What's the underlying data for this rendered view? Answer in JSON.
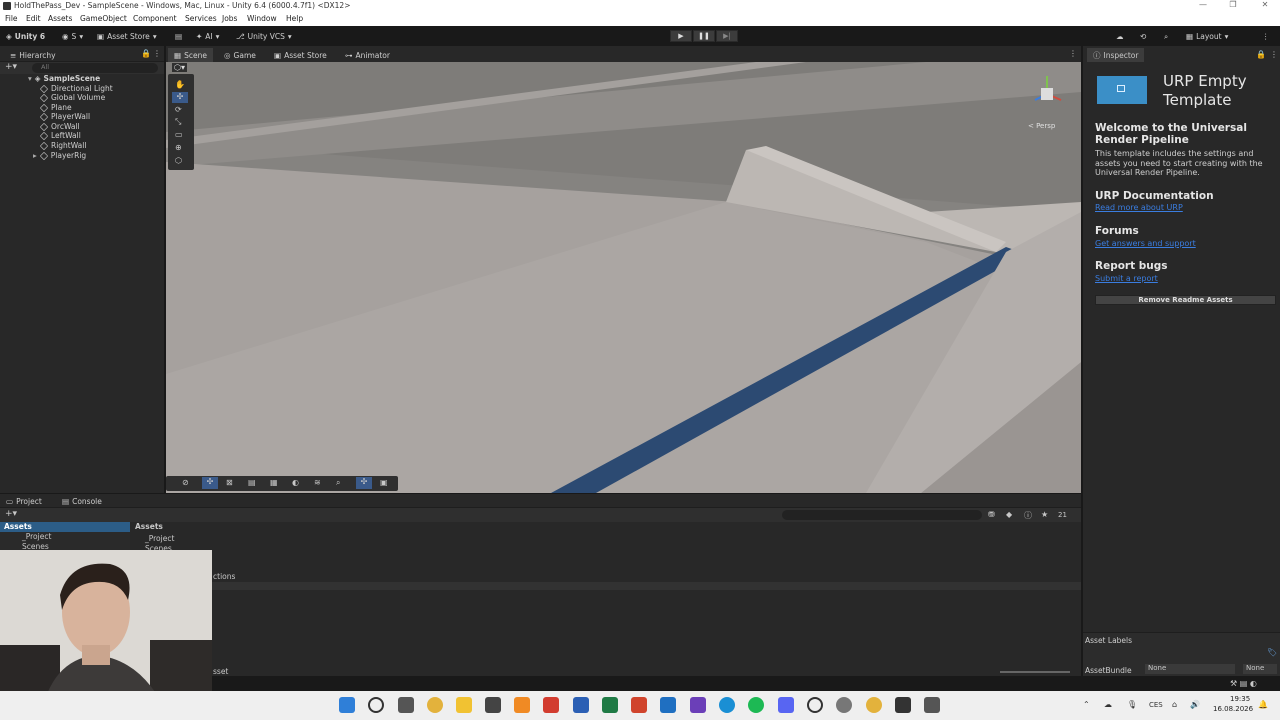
{
  "window": {
    "title": "HoldThePass_Dev - SampleScene - Windows, Mac, Linux - Unity 6.4 (6000.4.7f1) <DX12>"
  },
  "menu": [
    "File",
    "Edit",
    "Assets",
    "GameObject",
    "Component",
    "Services",
    "Jobs",
    "Window",
    "Help"
  ],
  "toolbar": {
    "unity": "Unity 6",
    "account": "S",
    "asset_store": "Asset Store",
    "ai": "AI",
    "vcs": "Unity VCS",
    "layout": "Layout"
  },
  "tabs": {
    "hierarchy": "Hierarchy",
    "scene": "Scene",
    "game": "Game",
    "asset_store": "Asset Store",
    "animator": "Animator",
    "inspector": "Inspector",
    "project": "Project",
    "console": "Console"
  },
  "hierarchy": {
    "search_placeholder": "All",
    "scene": "SampleScene",
    "items": [
      "Directional Light",
      "Global Volume",
      "Plane",
      "PlayerWall",
      "OrcWall",
      "LeftWall",
      "RightWall",
      "PlayerRig"
    ]
  },
  "scene_view": {
    "persp": "< Persp"
  },
  "inspector": {
    "title": "URP Empty Template",
    "welcome_heading": "Welcome to the Universal Render Pipeline",
    "welcome_text": "This template includes the settings and assets you need to start creating with the Universal Render Pipeline.",
    "docs_heading": "URP Documentation",
    "docs_link": "Read more about URP",
    "forums_heading": "Forums",
    "forums_link": "Get answers and support",
    "bugs_heading": "Report bugs",
    "bugs_link": "Submit a report",
    "remove_button": "Remove Readme Assets",
    "asset_labels": "Asset Labels",
    "asset_bundle_label": "AssetBundle",
    "asset_bundle_value": "None",
    "asset_bundle_variant": "None"
  },
  "project": {
    "tree_root": "Assets",
    "tree_items": [
      "_Project",
      "Scenes"
    ],
    "breadcrumb": "Assets",
    "folders": [
      "_Project",
      "Scenes"
    ],
    "partial_text": "ctions",
    "footer_partial": "sset",
    "hidden_count": "21"
  },
  "taskbar": {
    "lang": "CES",
    "time": "19:35",
    "date": "16.08.2026"
  },
  "colors": {
    "accent": "#3a7de0",
    "scene_floor": "#a8a3a0",
    "stripe": "#2c4a72"
  }
}
